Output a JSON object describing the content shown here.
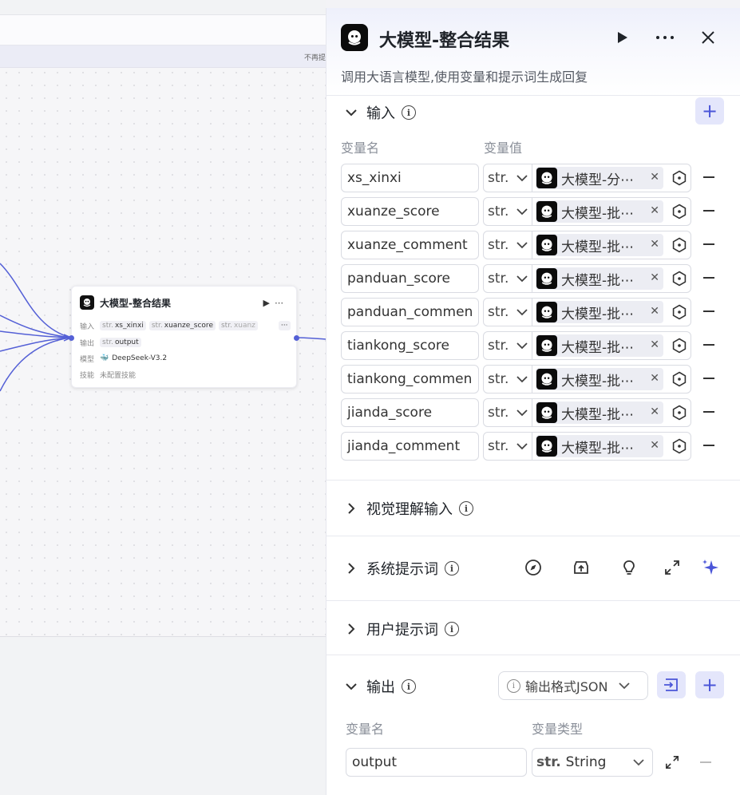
{
  "canvas": {
    "hint_text": "不再提",
    "node": {
      "title": "大模型-整合结果",
      "input_label": "输入",
      "inputs": [
        "xs_xinxi",
        "xuanze_score",
        "xuanz"
      ],
      "output_label": "输出",
      "output": "output",
      "model_label": "模型",
      "model": "DeepSeek-V3.2",
      "skills_label": "技能",
      "skills": "未配置技能",
      "type_prefix": "str.",
      "more": "···"
    }
  },
  "panel": {
    "title": "大模型-整合结果",
    "description": "调用大语言模型,使用变量和提示词生成回复",
    "input_section": {
      "title": "输入",
      "col_name": "变量名",
      "col_value": "变量值",
      "rows": [
        {
          "name": "xs_xinxi",
          "type": "str.",
          "ref": "大模型-分⋯"
        },
        {
          "name": "xuanze_score",
          "type": "str.",
          "ref": "大模型-批⋯"
        },
        {
          "name": "xuanze_comment",
          "type": "str.",
          "ref": "大模型-批⋯"
        },
        {
          "name": "panduan_score",
          "type": "str.",
          "ref": "大模型-批⋯"
        },
        {
          "name": "panduan_commen",
          "type": "str.",
          "ref": "大模型-批⋯"
        },
        {
          "name": "tiankong_score",
          "type": "str.",
          "ref": "大模型-批⋯"
        },
        {
          "name": "tiankong_commen",
          "type": "str.",
          "ref": "大模型-批⋯"
        },
        {
          "name": "jianda_score",
          "type": "str.",
          "ref": "大模型-批⋯"
        },
        {
          "name": "jianda_comment",
          "type": "str.",
          "ref": "大模型-批⋯"
        }
      ]
    },
    "vision_section": {
      "title": "视觉理解输入"
    },
    "system_prompt_section": {
      "title": "系统提示词"
    },
    "user_prompt_section": {
      "title": "用户提示词"
    },
    "output_section": {
      "title": "输出",
      "format_label": "输出格式JSON",
      "col_name": "变量名",
      "col_type": "变量类型",
      "row": {
        "name": "output",
        "type_prefix": "str.",
        "type": "String"
      }
    }
  },
  "colors": {
    "accent": "#4a55d8",
    "accent_bg": "#e4e6fb",
    "edge": "#5460d6"
  }
}
